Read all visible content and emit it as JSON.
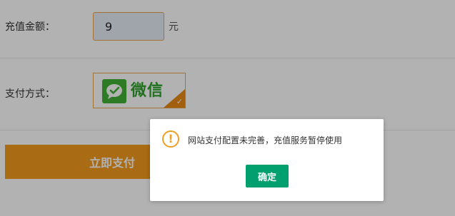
{
  "form": {
    "amount_label": "充值金额：",
    "amount_value": "9",
    "amount_unit": "元",
    "payment_label": "支付方式：",
    "payment_option": {
      "logo_icon": "wechat-logo-icon",
      "text": "微信",
      "selected": true
    },
    "submit_label": "立即支付"
  },
  "dialog": {
    "icon": "warning-icon",
    "icon_glyph": "!",
    "message": "网站支付配置未完善，充值服务暂停使用",
    "confirm_label": "确定"
  },
  "colors": {
    "accent": "#e98a16",
    "wechat_green": "#41b035",
    "confirm_green": "#009f6e",
    "warning": "#f0a020"
  }
}
